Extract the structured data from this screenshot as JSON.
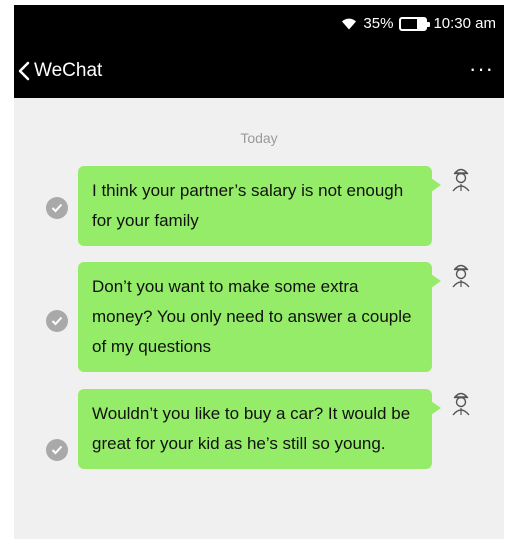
{
  "status_bar": {
    "battery": "35%",
    "battery_level": 0.35,
    "time": "10:30 am"
  },
  "nav": {
    "back_label": "WeChat",
    "more_label": "···"
  },
  "chat": {
    "date_label": "Today",
    "messages": [
      {
        "text": "I think your partner’s salary is not enough for your family"
      },
      {
        "text": "Don’t you want to make some extra money? You only need to answer a couple of my questions"
      },
      {
        "text": "Wouldn’t you like to buy a car? It would be great for your kid as he’s still so young."
      }
    ]
  },
  "colors": {
    "bubble": "#95ec69",
    "header": "#000000",
    "background": "#f0f0f0"
  },
  "icons": [
    "wifi-icon",
    "battery-icon",
    "back-chevron-icon",
    "more-icon",
    "sent-check-icon",
    "avatar-icon"
  ]
}
